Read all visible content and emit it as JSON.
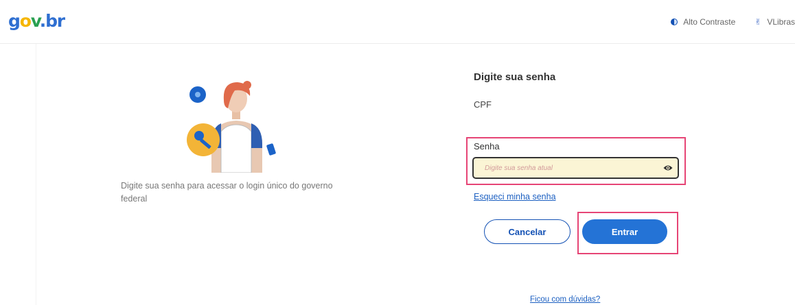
{
  "header": {
    "logo_parts": [
      "g",
      "o",
      "v",
      ".",
      "br"
    ],
    "contrast_label": "Alto Contraste",
    "vlibras_label": "VLibras"
  },
  "left": {
    "illustration": "person-with-key-illustration",
    "description": "Digite sua senha para acessar o login único do governo federal"
  },
  "form": {
    "title": "Digite sua senha",
    "cpf_label": "CPF",
    "password_label": "Senha",
    "password_placeholder": "Digite sua senha atual",
    "password_value": "",
    "forgot_link": "Esqueci minha senha",
    "cancel_button": "Cancelar",
    "submit_button": "Entrar",
    "help_link": "Ficou com dúvidas?"
  },
  "icons": {
    "contrast": "contrast-icon",
    "vlibras": "vlibras-icon",
    "password_toggle": "eye-icon"
  },
  "colors": {
    "primary": "#1351b4",
    "button_blue": "#2473d6",
    "highlight": "#e64475",
    "input_bg": "#fbf5d5",
    "logo_blue": "#2f6fd1",
    "logo_yellow": "#f6b600",
    "logo_green": "#2aa051"
  }
}
